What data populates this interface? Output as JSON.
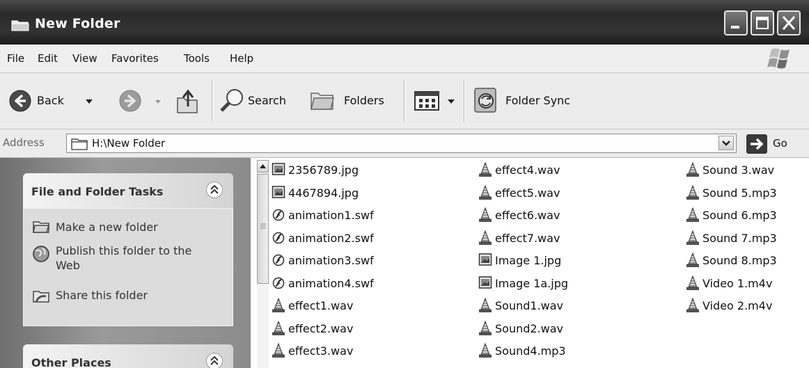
{
  "window": {
    "title": "New Folder"
  },
  "menu": [
    "File",
    "Edit",
    "View",
    "Favorites",
    "Tools",
    "Help"
  ],
  "toolbar": {
    "back": "Back",
    "search": "Search",
    "folders": "Folders",
    "folder_sync": "Folder Sync"
  },
  "address": {
    "label": "Address",
    "value": "H:\\New Folder",
    "go": "Go"
  },
  "left_pane": {
    "file_tasks": {
      "title": "File and Folder Tasks",
      "items": [
        "Make a new folder",
        "Publish this folder to the Web",
        "Share this folder"
      ]
    },
    "other_places": {
      "title": "Other Places"
    }
  },
  "files": {
    "columns": [
      [
        {
          "name": "2356789.jpg",
          "icon": "image-file-icon"
        },
        {
          "name": "4467894.jpg",
          "icon": "image-file-icon"
        },
        {
          "name": "animation1.swf",
          "icon": "flash-file-icon"
        },
        {
          "name": "animation2.swf",
          "icon": "flash-file-icon"
        },
        {
          "name": "animation3.swf",
          "icon": "flash-file-icon"
        },
        {
          "name": "animation4.swf",
          "icon": "flash-file-icon"
        },
        {
          "name": "effect1.wav",
          "icon": "media-cone-icon"
        },
        {
          "name": "effect2.wav",
          "icon": "media-cone-icon"
        },
        {
          "name": "effect3.wav",
          "icon": "media-cone-icon"
        }
      ],
      [
        {
          "name": "effect4.wav",
          "icon": "media-cone-icon"
        },
        {
          "name": "effect5.wav",
          "icon": "media-cone-icon"
        },
        {
          "name": "effect6.wav",
          "icon": "media-cone-icon"
        },
        {
          "name": "effect7.wav",
          "icon": "media-cone-icon"
        },
        {
          "name": "Image 1.jpg",
          "icon": "image-file-icon"
        },
        {
          "name": "Image 1a.jpg",
          "icon": "image-file-icon"
        },
        {
          "name": "Sound1.wav",
          "icon": "media-cone-icon"
        },
        {
          "name": "Sound2.wav",
          "icon": "media-cone-icon"
        },
        {
          "name": "Sound4.mp3",
          "icon": "media-cone-icon"
        }
      ],
      [
        {
          "name": "Sound 3.wav",
          "icon": "media-cone-icon"
        },
        {
          "name": "Sound 5.mp3",
          "icon": "media-cone-icon"
        },
        {
          "name": "Sound 6.mp3",
          "icon": "media-cone-icon"
        },
        {
          "name": "Sound 7.mp3",
          "icon": "media-cone-icon"
        },
        {
          "name": "Sound 8.mp3",
          "icon": "media-cone-icon"
        },
        {
          "name": "Video 1.m4v",
          "icon": "media-cone-icon"
        },
        {
          "name": "Video 2.m4v",
          "icon": "media-cone-icon"
        }
      ]
    ]
  }
}
